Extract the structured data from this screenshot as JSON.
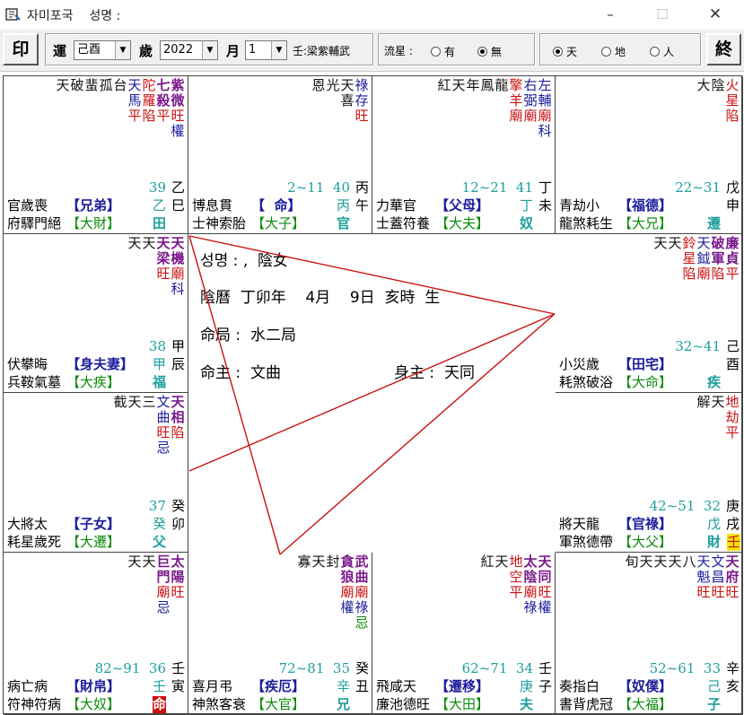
{
  "window": {
    "title": "자미포국    성명 :",
    "min_icon": "–",
    "max_icon": "☐",
    "close_icon": "✕"
  },
  "toolbar": {
    "print_label": "印",
    "luck_label": "運",
    "luck_value": "己酉",
    "year_label": "歲",
    "year_value": "2022",
    "month_label": "月",
    "month_value": "1",
    "sihua_text": "壬:梁紫輔武",
    "flow_label": "流星 :",
    "flow_options": [
      "有",
      "無"
    ],
    "flow_selected": "無",
    "view_options": [
      "天",
      "地",
      "人"
    ],
    "view_selected": "天",
    "exit_label": "終"
  },
  "center": {
    "line1": "성명 : ,  陰女",
    "line2": "陰曆  丁卯年    4月    9日  亥時  生",
    "line3": "命局 :  水二局",
    "line4_left": "命主 :  文曲",
    "line4_right": "身主 :  天同"
  },
  "palaces": [
    {
      "id": "si",
      "row": 0,
      "col": 0,
      "stars": [
        [
          "天",
          ""
        ],
        [
          "破",
          ""
        ],
        [
          "蜚",
          ""
        ],
        [
          "孤",
          ""
        ],
        [
          "台",
          ""
        ],
        [
          "天",
          "馬"
        ],
        [
          "陀",
          "羅"
        ],
        [
          "七",
          "殺"
        ],
        [
          "紫",
          "微"
        ]
      ],
      "status": [
        "",
        "",
        "",
        "",
        "",
        "平",
        "陷",
        "平",
        "旺"
      ],
      "extra": [
        "",
        "",
        "",
        "",
        "",
        "",
        "",
        "",
        "權"
      ],
      "age": "39",
      "stem": "乙",
      "branch": "巳",
      "stem_b": "乙",
      "branch_b": "田",
      "left1": "官歲喪",
      "left2": "府驛門絕",
      "name1": "【兄弟】",
      "name2": "【大財】"
    },
    {
      "id": "wu",
      "row": 0,
      "col": 1,
      "stars": [
        [
          "恩",
          ""
        ],
        [
          "光",
          ""
        ],
        [
          "天",
          "喜"
        ],
        [
          "祿",
          "存"
        ]
      ],
      "status": [
        "",
        "",
        "",
        "旺"
      ],
      "age": "2~11  40",
      "stem": "丙",
      "branch": "午",
      "stem_b": "丙",
      "branch_b": "官",
      "left1": "博息貫",
      "left2": "士神索胎",
      "name1": "【  命】",
      "name2": "【大子】"
    },
    {
      "id": "wei",
      "row": 0,
      "col": 2,
      "stars": [
        [
          "紅",
          ""
        ],
        [
          "天",
          ""
        ],
        [
          "年",
          ""
        ],
        [
          "鳳",
          ""
        ],
        [
          "龍",
          ""
        ],
        [
          "擎",
          "羊"
        ],
        [
          "右",
          "弼"
        ],
        [
          "左",
          "輔"
        ]
      ],
      "status": [
        "",
        "",
        "",
        "",
        "",
        "廟",
        "廟",
        "廟"
      ],
      "extra": [
        "",
        "",
        "",
        "",
        "",
        "",
        "",
        "科"
      ],
      "age": "12~21  41",
      "stem": "丁",
      "branch": "未",
      "stem_b": "丁",
      "branch_b": "奴",
      "left1": "力華官",
      "left2": "士蓋符養",
      "name1": "【父母】",
      "name2": "【大夫】"
    },
    {
      "id": "shen",
      "row": 0,
      "col": 3,
      "stars": [
        [
          "大",
          ""
        ],
        [
          "陰",
          ""
        ],
        [
          "火",
          "星"
        ]
      ],
      "status": [
        "",
        "",
        "陷"
      ],
      "age": "22~31",
      "stem": "戊",
      "branch": "申",
      "stem_b": "",
      "branch_b": "遷",
      "left1": "青劫小",
      "left2": "龍煞耗生",
      "name1": "【福德】",
      "name2": "【大兄】"
    },
    {
      "id": "chen",
      "row": 1,
      "col": 0,
      "stars": [
        [
          "天",
          ""
        ],
        [
          "天",
          ""
        ],
        [
          "天",
          "梁"
        ],
        [
          "天",
          "機"
        ]
      ],
      "status": [
        "",
        "",
        "旺",
        "廟"
      ],
      "extra": [
        "",
        "",
        "",
        "科"
      ],
      "age": "38",
      "stem": "甲",
      "branch": "辰",
      "stem_b": "甲",
      "branch_b": "福",
      "left1": "伏攀晦",
      "left2": "兵鞍氣墓",
      "name1": "【身夫妻】",
      "name2": "【大疾】"
    },
    {
      "id": "you",
      "row": 1,
      "col": 3,
      "stars": [
        [
          "天",
          ""
        ],
        [
          "天",
          ""
        ],
        [
          "鈴",
          "星"
        ],
        [
          "天",
          "鉞"
        ],
        [
          "破",
          "軍"
        ],
        [
          "廉",
          "貞"
        ]
      ],
      "status": [
        "",
        "",
        "陷",
        "廟",
        "陷",
        "平"
      ],
      "age": "32~41",
      "stem": "己",
      "branch": "酉",
      "stem_b": "",
      "branch_b": "疾",
      "left1": "小災歲",
      "left2": "耗煞破浴",
      "name1": "【田宅】",
      "name2": "【大命】"
    },
    {
      "id": "mao",
      "row": 2,
      "col": 0,
      "stars": [
        [
          "截",
          ""
        ],
        [
          "天",
          ""
        ],
        [
          "三",
          ""
        ],
        [
          "文",
          "曲"
        ],
        [
          "天",
          "相"
        ]
      ],
      "status": [
        "",
        "",
        "",
        "旺",
        "陷"
      ],
      "extra": [
        "",
        "",
        "",
        "忌",
        ""
      ],
      "age": "37",
      "stem": "癸",
      "branch": "卯",
      "stem_b": "癸",
      "branch_b": "父",
      "left1": "大將太",
      "left2": "耗星歲死",
      "name1": "【子女】",
      "name2": "【大遷】"
    },
    {
      "id": "xu",
      "row": 2,
      "col": 3,
      "stars": [
        [
          "解",
          ""
        ],
        [
          "天",
          ""
        ],
        [
          "地",
          "劫"
        ]
      ],
      "status": [
        "",
        "",
        "平"
      ],
      "age": "42~51  32",
      "stem": "庚",
      "branch": "戌",
      "stem_b": "戊",
      "branch_b": "財",
      "left1": "將天龍",
      "left2": "軍煞德帶",
      "name1": "【官祿】",
      "name2": "【大父】"
    },
    {
      "id": "yin",
      "row": 3,
      "col": 0,
      "stars": [
        [
          "天",
          ""
        ],
        [
          "天",
          ""
        ],
        [
          "巨",
          "門"
        ],
        [
          "太",
          "陽"
        ]
      ],
      "status": [
        "",
        "",
        "廟",
        "旺"
      ],
      "extra": [
        "",
        "",
        "忌",
        ""
      ],
      "age": "82~91  36",
      "stem": "壬",
      "branch": "寅",
      "stem_b": "壬",
      "branch_b": "命",
      "left1": "病亡病",
      "left2": "符神符病",
      "name1": "【財帛】",
      "name2": "【大奴】"
    },
    {
      "id": "chou",
      "row": 3,
      "col": 1,
      "stars": [
        [
          "寡",
          ""
        ],
        [
          "天",
          ""
        ],
        [
          "封",
          ""
        ],
        [
          "貪",
          "狼"
        ],
        [
          "武",
          "曲"
        ]
      ],
      "status": [
        "",
        "",
        "",
        "廟",
        "廟"
      ],
      "extra": [
        "",
        "",
        "",
        "權",
        "祿"
      ],
      "extra2": [
        "",
        "",
        "",
        "",
        "忌"
      ],
      "age": "72~81  35",
      "stem": "癸",
      "branch": "丑",
      "stem_b": "辛",
      "branch_b": "兄",
      "left1": "喜月弔",
      "left2": "神煞客衰",
      "name1": "【疾厄】",
      "name2": "【大官】"
    },
    {
      "id": "zi",
      "row": 3,
      "col": 2,
      "stars": [
        [
          "紅",
          ""
        ],
        [
          "天",
          ""
        ],
        [
          "地",
          "空"
        ],
        [
          "太",
          "陰"
        ],
        [
          "天",
          "同"
        ]
      ],
      "status": [
        "",
        "",
        "平",
        "廟",
        "旺"
      ],
      "extra": [
        "",
        "",
        "",
        "祿",
        "權"
      ],
      "age": "62~71  34",
      "stem": "壬",
      "branch": "子",
      "stem_b": "庚",
      "branch_b": "夫",
      "left1": "飛咸天",
      "left2": "廉池德旺",
      "name1": "【遷移】",
      "name2": "【大田】"
    },
    {
      "id": "hai",
      "row": 3,
      "col": 3,
      "stars": [
        [
          "旬",
          ""
        ],
        [
          "天",
          ""
        ],
        [
          "天",
          ""
        ],
        [
          "天",
          ""
        ],
        [
          "八",
          ""
        ],
        [
          "天",
          "魁"
        ],
        [
          "文",
          "昌"
        ],
        [
          "天",
          "府"
        ]
      ],
      "status": [
        "",
        "",
        "",
        "",
        "",
        "旺",
        "旺",
        "旺"
      ],
      "age": "52~61  33",
      "stem": "辛",
      "branch": "亥",
      "stem_b": "己",
      "branch_b": "子",
      "left1": "奏指白",
      "left2": "書背虎冠",
      "name1": "【奴僕】",
      "name2": "【大福】"
    }
  ],
  "colors": {
    "red": "#cc1111",
    "blue": "#1c1c9c",
    "purple": "#7a1a8a",
    "teal": "#1e9e9e",
    "green": "#0a8a0a"
  }
}
